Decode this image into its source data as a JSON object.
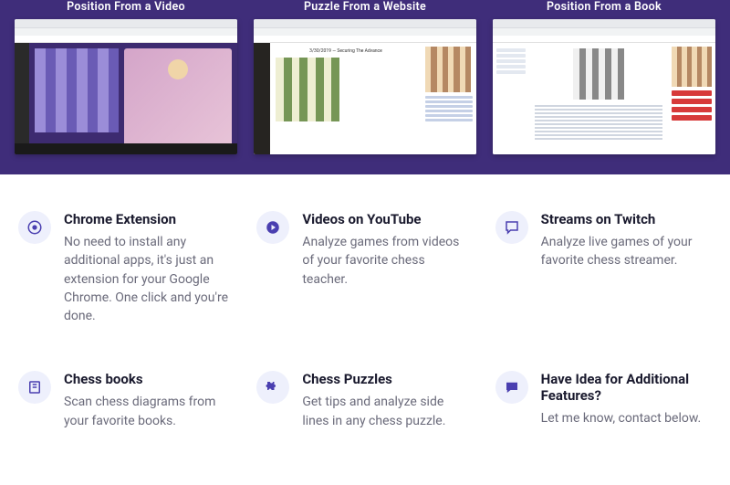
{
  "hero": {
    "cols": [
      {
        "title": "Position From a Video"
      },
      {
        "title": "Puzzle From a Website"
      },
      {
        "title": "Position From a Book"
      }
    ]
  },
  "features": {
    "row1": [
      {
        "title": "Chrome Extension",
        "desc": "No need to install any additional apps, it's just an extension for your Google Chrome. One click and you're done."
      },
      {
        "title": "Videos on YouTube",
        "desc": "Analyze games from videos of your favorite chess teacher."
      },
      {
        "title": "Streams on Twitch",
        "desc": "Analyze live games of your favorite chess streamer."
      }
    ],
    "row2": [
      {
        "title": "Chess books",
        "desc": "Scan chess diagrams from your favorite books."
      },
      {
        "title": "Chess Puzzles",
        "desc": "Get tips and analyze side lines in any chess puzzle."
      },
      {
        "title": "Have Idea for Additional Features?",
        "desc": "Let me know, contact below."
      }
    ]
  }
}
